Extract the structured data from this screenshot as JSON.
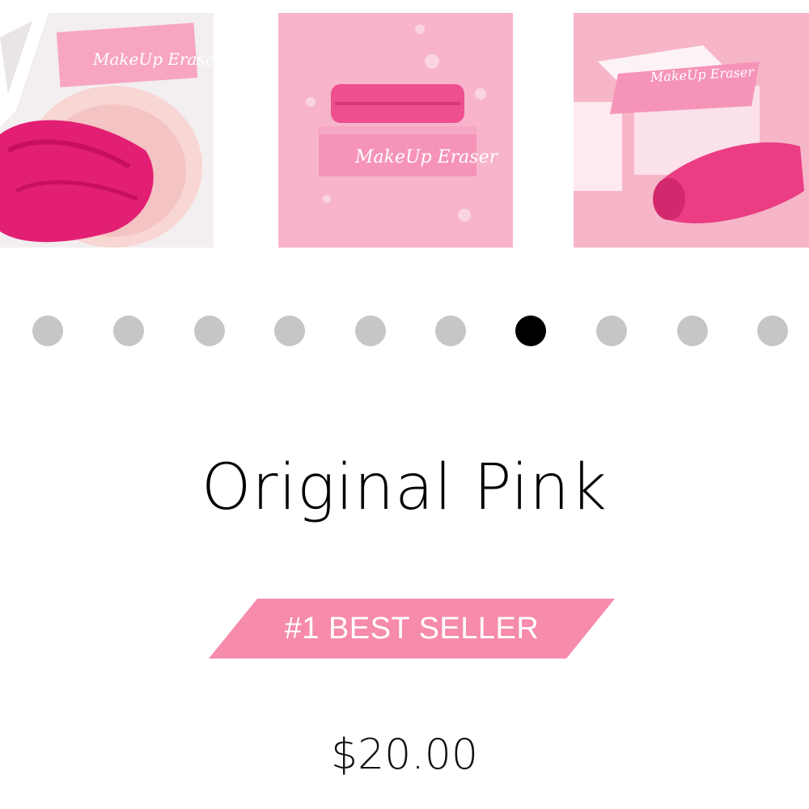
{
  "gallery": {
    "thumbnails": [
      {
        "alt": "Makeup Eraser in bowl",
        "box_text": "MakeUp Eraser"
      },
      {
        "alt": "Makeup Eraser with water drops",
        "box_text": "MakeUp Eraser"
      },
      {
        "alt": "Makeup Eraser on pedestals",
        "box_text": "MakeUp Eraser"
      }
    ],
    "dot_count": 10,
    "active_dot": 7
  },
  "product": {
    "title": "Original Pink",
    "badge": "#1 BEST SELLER",
    "price": "$20.00"
  },
  "colors": {
    "accent": "#f68bab",
    "brand_pink": "#f2679a",
    "dot_inactive": "#c6c6c6",
    "dot_active": "#000000"
  }
}
